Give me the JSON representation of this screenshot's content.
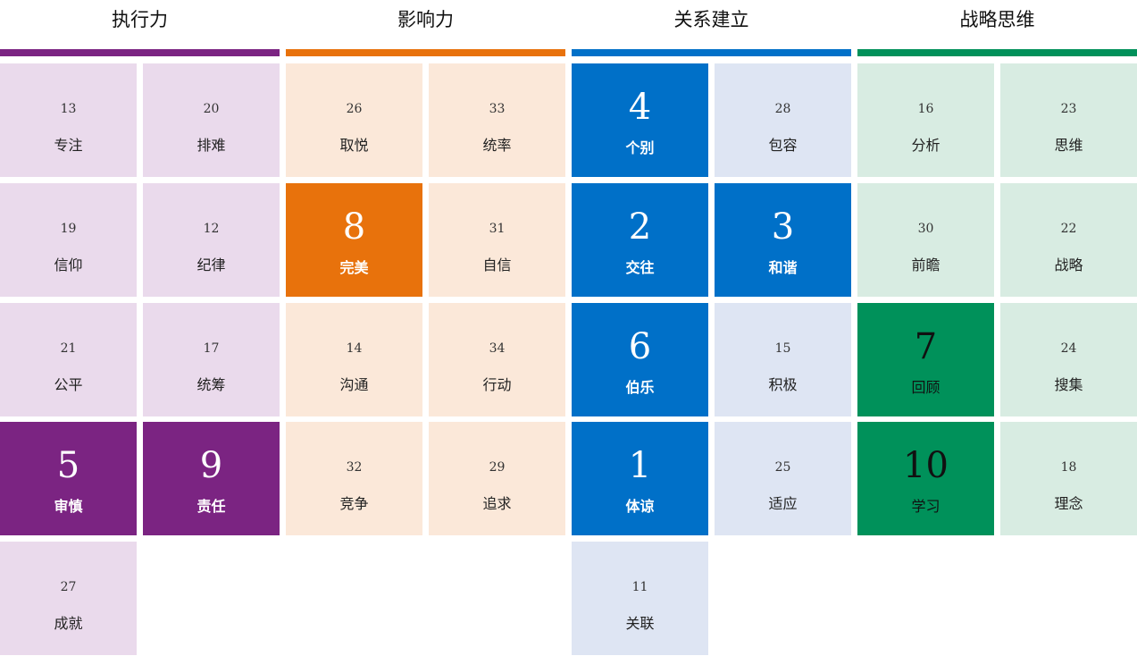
{
  "colors": {
    "executing": {
      "bar": "#7B2482",
      "light": "#EADAEC"
    },
    "influencing": {
      "bar": "#E8720C",
      "light": "#FBE8D9"
    },
    "relationship": {
      "bar": "#0070C8",
      "light": "#DEE5F3"
    },
    "strategic": {
      "bar": "#00915A",
      "light": "#D8ECE2"
    }
  },
  "domains": [
    {
      "key": "executing",
      "title": "执行力",
      "strengths": [
        {
          "rank": "13",
          "name": "专注"
        },
        {
          "rank": "20",
          "name": "排难"
        },
        {
          "rank": "19",
          "name": "信仰"
        },
        {
          "rank": "12",
          "name": "纪律"
        },
        {
          "rank": "21",
          "name": "公平"
        },
        {
          "rank": "17",
          "name": "统筹"
        },
        {
          "rank": "5",
          "name": "审慎",
          "top5": true
        },
        {
          "rank": "9",
          "name": "责任",
          "top5": true
        },
        {
          "rank": "27",
          "name": "成就"
        }
      ]
    },
    {
      "key": "influencing",
      "title": "影响力",
      "strengths": [
        {
          "rank": "26",
          "name": "取悦"
        },
        {
          "rank": "33",
          "name": "统率"
        },
        {
          "rank": "8",
          "name": "完美",
          "top5": true
        },
        {
          "rank": "31",
          "name": "自信"
        },
        {
          "rank": "14",
          "name": "沟通"
        },
        {
          "rank": "34",
          "name": "行动"
        },
        {
          "rank": "32",
          "name": "竞争"
        },
        {
          "rank": "29",
          "name": "追求"
        }
      ]
    },
    {
      "key": "relationship",
      "title": "关系建立",
      "strengths": [
        {
          "rank": "4",
          "name": "个别",
          "top5": true
        },
        {
          "rank": "28",
          "name": "包容"
        },
        {
          "rank": "2",
          "name": "交往",
          "top5": true
        },
        {
          "rank": "3",
          "name": "和谐",
          "top5": true
        },
        {
          "rank": "6",
          "name": "伯乐",
          "top5": true
        },
        {
          "rank": "15",
          "name": "积极"
        },
        {
          "rank": "1",
          "name": "体谅",
          "top5": true
        },
        {
          "rank": "25",
          "name": "适应"
        },
        {
          "rank": "11",
          "name": "关联"
        }
      ]
    },
    {
      "key": "strategic",
      "title": "战略思维",
      "strengths": [
        {
          "rank": "16",
          "name": "分析"
        },
        {
          "rank": "23",
          "name": "思维"
        },
        {
          "rank": "30",
          "name": "前瞻"
        },
        {
          "rank": "22",
          "name": "战略"
        },
        {
          "rank": "7",
          "name": "回顾",
          "top5": true
        },
        {
          "rank": "24",
          "name": "搜集"
        },
        {
          "rank": "10",
          "name": "学习",
          "top5": true
        },
        {
          "rank": "18",
          "name": "理念"
        }
      ]
    }
  ]
}
